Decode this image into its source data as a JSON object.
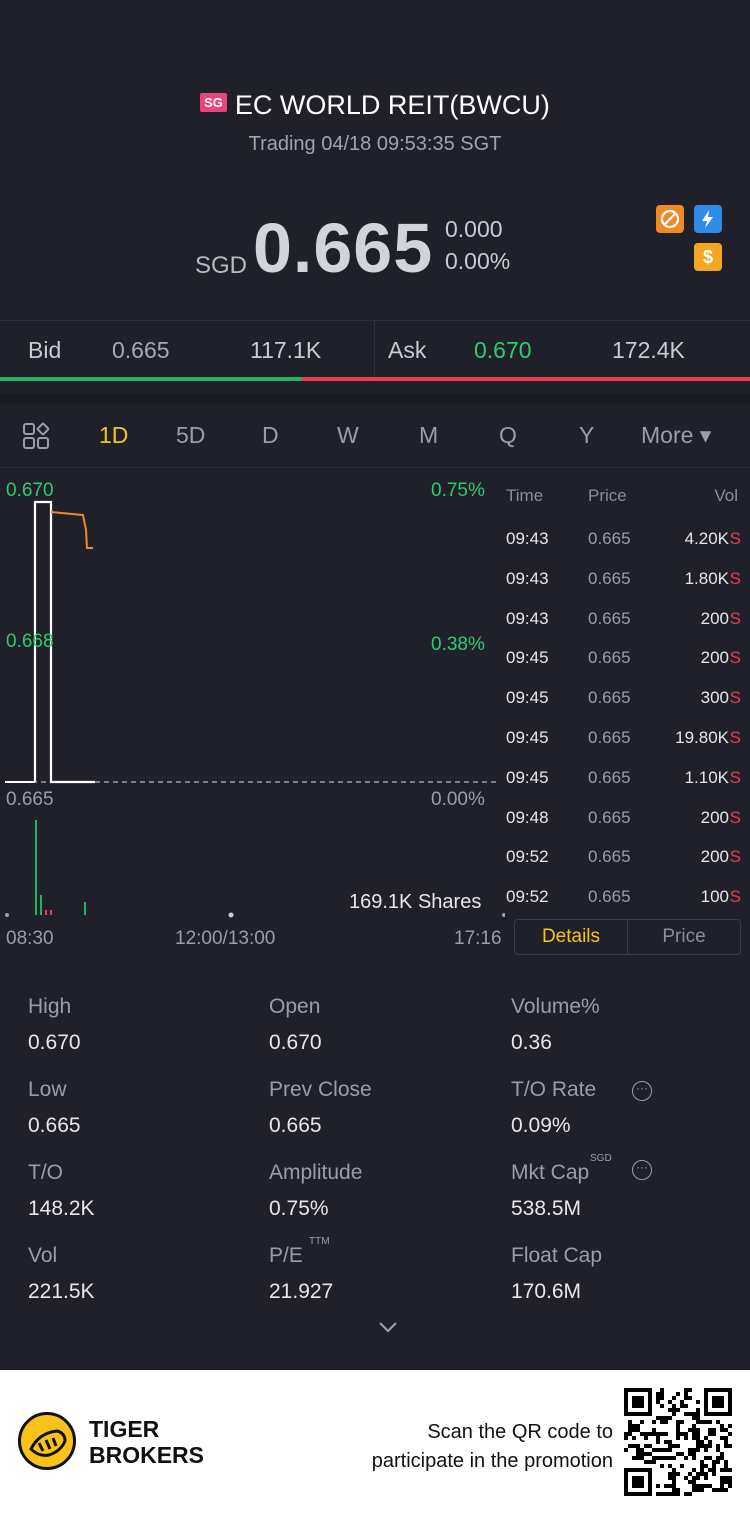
{
  "header": {
    "market_badge": "SG",
    "stock_name": "EC WORLD REIT(BWCU)",
    "status": "Trading 04/18 09:53:35 SGT",
    "currency": "SGD",
    "last_price": "0.665",
    "change": "0.000",
    "change_pct": "0.00%",
    "icons": [
      "no-short-sell-icon",
      "flash-icon",
      "dollar-icon"
    ]
  },
  "bidask": {
    "bid_label": "Bid",
    "bid_price": "0.665",
    "bid_vol": "117.1K",
    "ask_label": "Ask",
    "ask_price": "0.670",
    "ask_vol": "172.4K",
    "bid_ratio": 0.403
  },
  "tabs": {
    "items": [
      "1D",
      "5D",
      "D",
      "W",
      "M",
      "Q",
      "Y"
    ],
    "more_label": "More ▾",
    "active": "1D"
  },
  "chart": {
    "y_left": [
      "0.670",
      "0.668",
      "0.665"
    ],
    "y_right": [
      "0.75%",
      "0.38%",
      "0.00%"
    ],
    "x_labels": [
      "08:30",
      "12:00/13:00",
      "17:16"
    ],
    "shares_label": "169.1K Shares"
  },
  "chart_data": {
    "type": "line",
    "ylim": [
      0.665,
      0.67
    ],
    "prev_close": 0.665,
    "note_y_labels": [
      "0.670",
      "0.668",
      "0.665"
    ]
  },
  "trades": {
    "headers": {
      "time": "Time",
      "price": "Price",
      "vol": "Vol"
    },
    "rows": [
      {
        "time": "09:43",
        "price": "0.665",
        "vol": "4.20K",
        "side": "S"
      },
      {
        "time": "09:43",
        "price": "0.665",
        "vol": "1.80K",
        "side": "S"
      },
      {
        "time": "09:43",
        "price": "0.665",
        "vol": "200",
        "side": "S"
      },
      {
        "time": "09:45",
        "price": "0.665",
        "vol": "200",
        "side": "S"
      },
      {
        "time": "09:45",
        "price": "0.665",
        "vol": "300",
        "side": "S"
      },
      {
        "time": "09:45",
        "price": "0.665",
        "vol": "19.80K",
        "side": "S"
      },
      {
        "time": "09:45",
        "price": "0.665",
        "vol": "1.10K",
        "side": "S"
      },
      {
        "time": "09:48",
        "price": "0.665",
        "vol": "200",
        "side": "S"
      },
      {
        "time": "09:52",
        "price": "0.665",
        "vol": "200",
        "side": "S"
      },
      {
        "time": "09:52",
        "price": "0.665",
        "vol": "100",
        "side": "S"
      }
    ],
    "details_label": "Details",
    "price_label": "Price"
  },
  "stats": {
    "high": {
      "label": "High",
      "value": "0.670"
    },
    "open": {
      "label": "Open",
      "value": "0.670"
    },
    "volume_pct": {
      "label": "Volume%",
      "value": "0.36"
    },
    "low": {
      "label": "Low",
      "value": "0.665"
    },
    "prev_close": {
      "label": "Prev Close",
      "value": "0.665"
    },
    "to_rate": {
      "label": "T/O Rate",
      "value": "0.09%"
    },
    "to": {
      "label": "T/O",
      "value": "148.2K"
    },
    "amplitude": {
      "label": "Amplitude",
      "value": "0.75%"
    },
    "mkt_cap": {
      "label": "Mkt Cap",
      "value": "538.5M",
      "sup": "SGD"
    },
    "vol": {
      "label": "Vol",
      "value": "221.5K"
    },
    "pe": {
      "label": "P/E",
      "value": "21.927",
      "sup": "TTM"
    },
    "float_cap": {
      "label": "Float Cap",
      "value": "170.6M"
    }
  },
  "footer": {
    "brand_line1": "TIGER",
    "brand_line2": "BROKERS",
    "promo_line1": "Scan the QR code to",
    "promo_line2": "participate in the promotion"
  },
  "colors": {
    "background": "#1f2029",
    "green": "#26b15e",
    "red": "#ea3b4f",
    "accent": "#f7c31a",
    "price_line": "#f08a24"
  }
}
